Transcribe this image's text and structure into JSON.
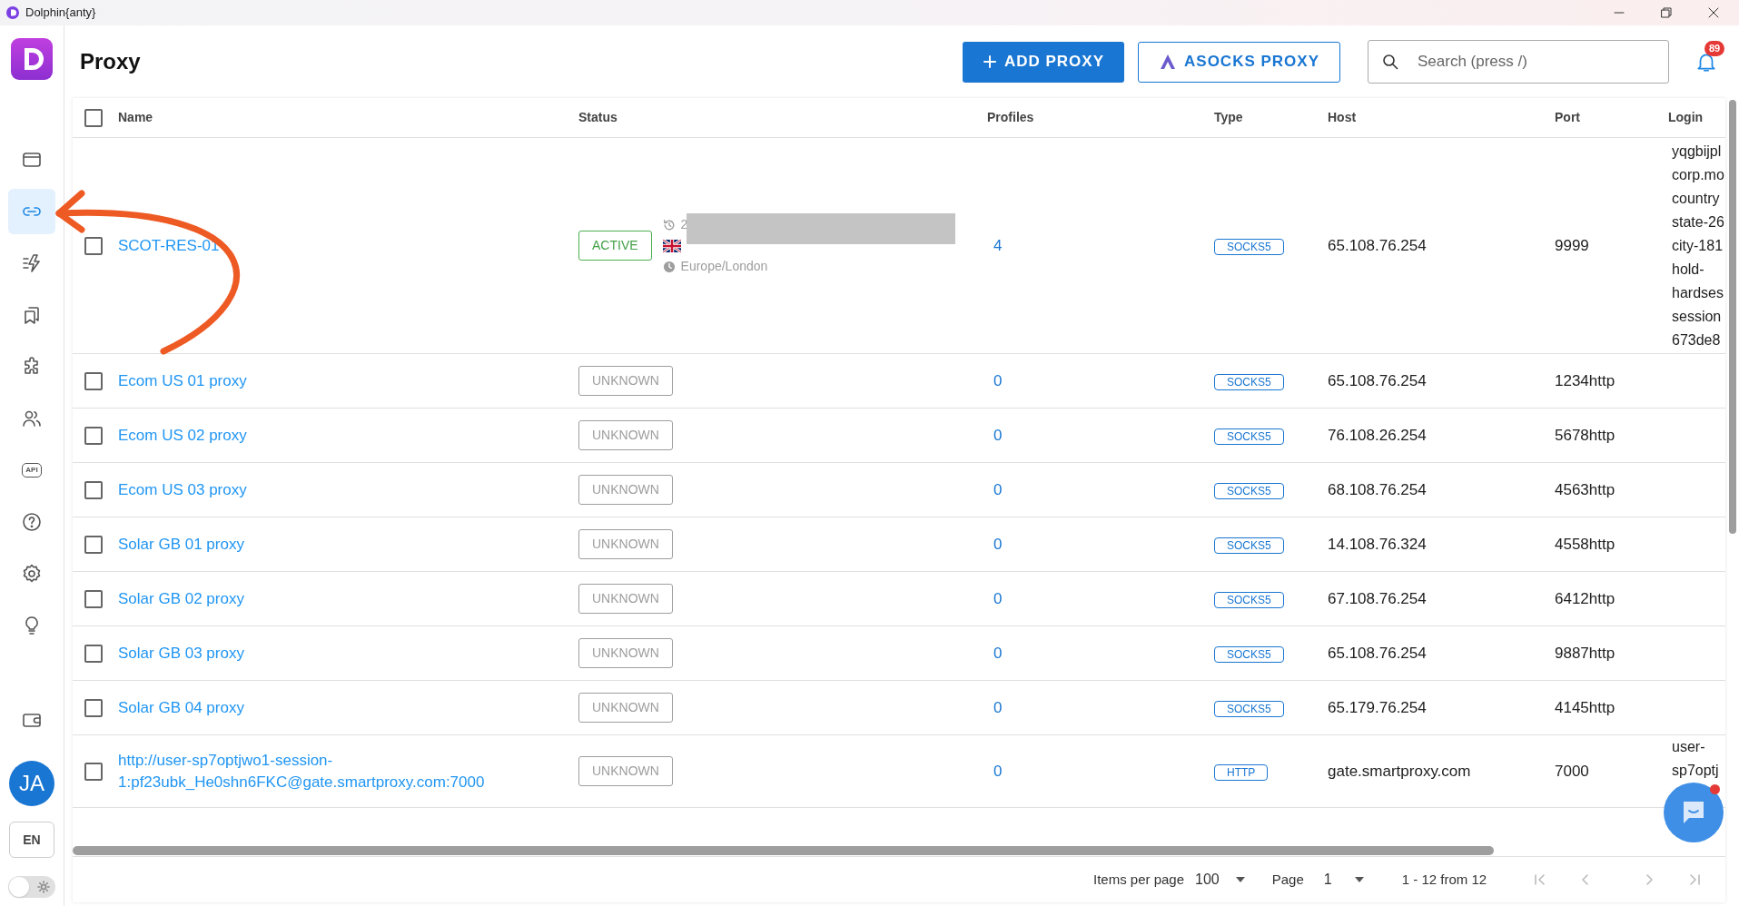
{
  "window": {
    "title": "Dolphin{anty}"
  },
  "sidebar": {
    "items": [
      {
        "kind": "browser",
        "selected": false
      },
      {
        "kind": "link",
        "selected": true
      },
      {
        "kind": "automation",
        "selected": false
      },
      {
        "kind": "bookmarks",
        "selected": false
      },
      {
        "kind": "extensions",
        "selected": false
      },
      {
        "kind": "users",
        "selected": false
      },
      {
        "kind": "api",
        "label": "API",
        "selected": false
      },
      {
        "kind": "help",
        "selected": false
      },
      {
        "kind": "settings",
        "selected": false
      },
      {
        "kind": "bulb",
        "selected": false
      },
      {
        "kind": "wallet",
        "selected": false
      }
    ],
    "avatar": {
      "initials": "JA"
    },
    "language": "EN",
    "dark_mode": false
  },
  "header": {
    "title": "Proxy",
    "buttons": [
      {
        "label": "ADD PROXY",
        "kind": "primary"
      },
      {
        "label": "ASOCKS PROXY",
        "kind": "outline"
      }
    ],
    "search": {
      "placeholder": "Search (press /)"
    },
    "notifications": {
      "count": "89"
    }
  },
  "table": {
    "columns": [
      "Name",
      "Status",
      "Profiles",
      "Type",
      "Host",
      "Port",
      "Login"
    ],
    "all_checked": false,
    "rows": [
      {
        "checked": false,
        "name": "SCOT-RES-01",
        "status": "ACTIVE",
        "active": true,
        "details": {
          "date": "2",
          "timezone": "Europe/London"
        },
        "profiles": "4",
        "type": "SOCKS5",
        "host": "65.108.76.254",
        "port": "9999",
        "login": [
          "yqgbijpl",
          "corp.mo",
          "country",
          "state-26",
          "city-181",
          "hold-",
          "hardses",
          "session",
          "673de8"
        ]
      },
      {
        "checked": false,
        "name": "Ecom US 01 proxy",
        "status": "UNKNOWN",
        "active": false,
        "profiles": "0",
        "type": "SOCKS5",
        "host": "65.108.76.254",
        "port": "1234http"
      },
      {
        "checked": false,
        "name": "Ecom US 02 proxy",
        "status": "UNKNOWN",
        "active": false,
        "profiles": "0",
        "type": "SOCKS5",
        "host": "76.108.26.254",
        "port": "5678http"
      },
      {
        "checked": false,
        "name": "Ecom US 03 proxy",
        "status": "UNKNOWN",
        "active": false,
        "profiles": "0",
        "type": "SOCKS5",
        "host": "68.108.76.254",
        "port": "4563http"
      },
      {
        "checked": false,
        "name": "Solar GB 01 proxy",
        "status": "UNKNOWN",
        "active": false,
        "profiles": "0",
        "type": "SOCKS5",
        "host": "14.108.76.324",
        "port": "4558http"
      },
      {
        "checked": false,
        "name": "Solar GB 02 proxy",
        "status": "UNKNOWN",
        "active": false,
        "profiles": "0",
        "type": "SOCKS5",
        "host": "67.108.76.254",
        "port": "6412http"
      },
      {
        "checked": false,
        "name": "Solar GB 03 proxy",
        "status": "UNKNOWN",
        "active": false,
        "profiles": "0",
        "type": "SOCKS5",
        "host": "65.108.76.254",
        "port": "9887http"
      },
      {
        "checked": false,
        "name": "Solar GB 04 proxy",
        "status": "UNKNOWN",
        "active": false,
        "profiles": "0",
        "type": "SOCKS5",
        "host": "65.179.76.254",
        "port": "4145http"
      },
      {
        "checked": false,
        "name": "http://user-sp7optjwo1-session-1:pf23ubk_He0shn6FKC@gate.smartproxy.com:7000",
        "status": "UNKNOWN",
        "active": false,
        "profiles": "0",
        "type": "HTTP",
        "host": "gate.smartproxy.com",
        "port": "7000",
        "login": [
          "user-",
          "sp7optj"
        ]
      }
    ]
  },
  "pagination": {
    "items_per_page_label": "Items per page",
    "items_per_page": "100",
    "page_label": "Page",
    "page": "1",
    "range": "1 - 12 from 12"
  }
}
